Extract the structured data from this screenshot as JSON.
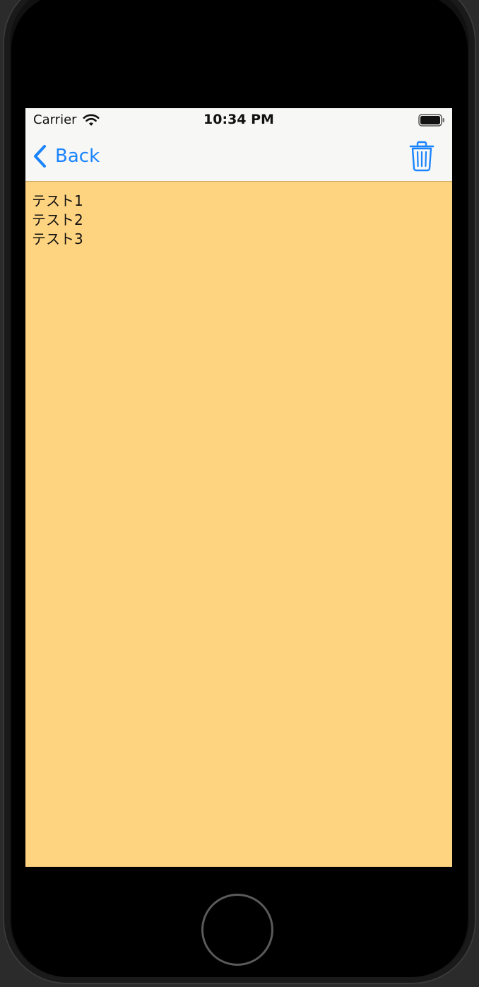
{
  "status_bar": {
    "carrier": "Carrier",
    "time": "10:34 PM",
    "wifi_icon": "wifi-icon",
    "battery_icon": "battery-full-icon"
  },
  "nav_bar": {
    "back_label": "Back",
    "back_icon": "chevron-left-icon",
    "trash_icon": "trash-icon",
    "tint_color": "#1A84FF"
  },
  "content": {
    "lines": [
      "テスト1",
      "テスト2",
      "テスト3"
    ],
    "background_color": "#FFD480"
  }
}
